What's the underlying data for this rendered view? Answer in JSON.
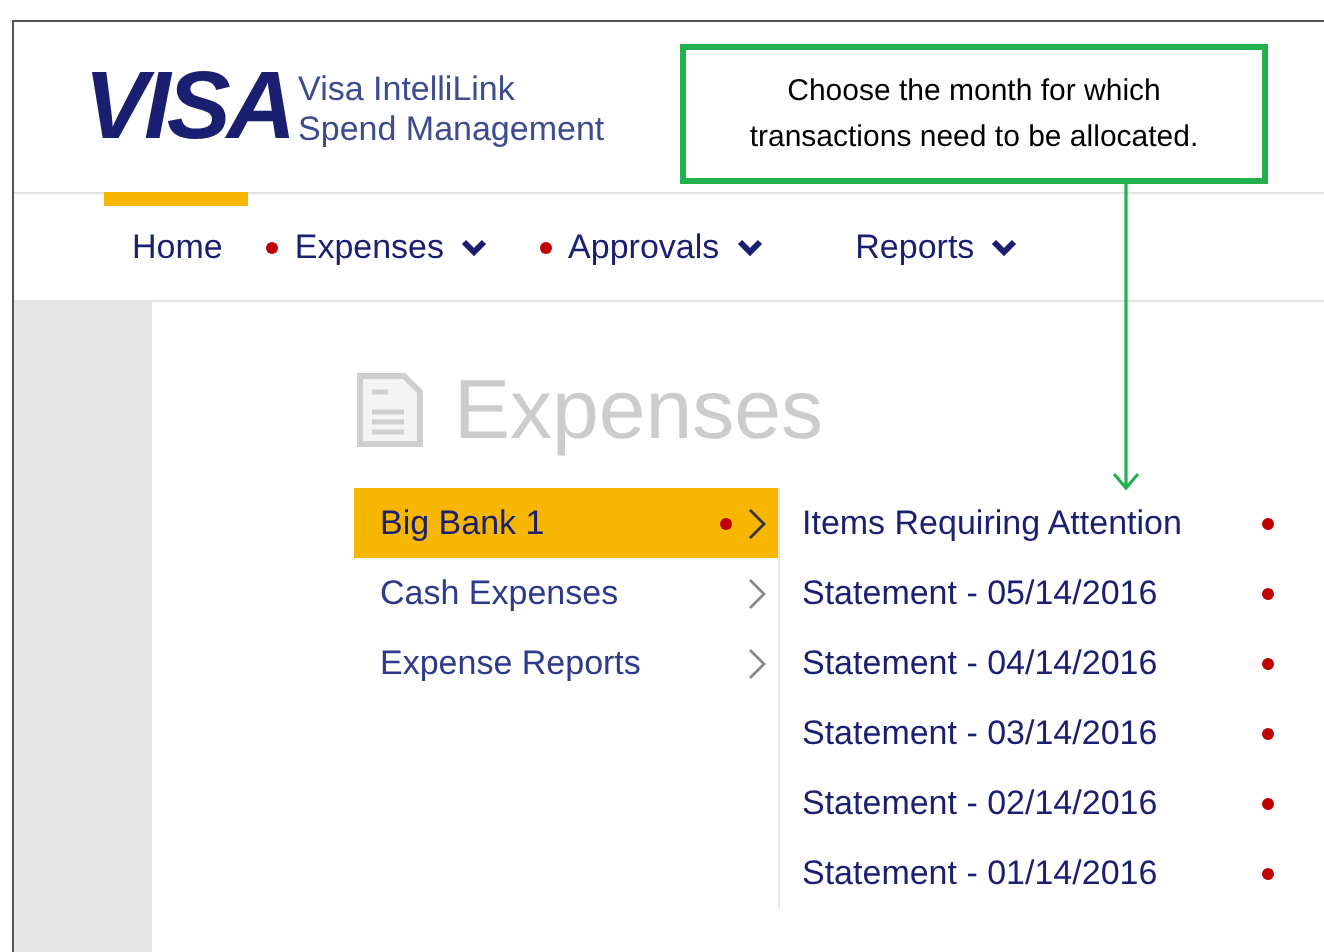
{
  "header": {
    "logo": "VISA",
    "product_lines": [
      "Visa IntelliLink",
      "Spend Management"
    ]
  },
  "nav": [
    {
      "label": "Home",
      "selected": true,
      "alert": false,
      "dropdown": false
    },
    {
      "label": "Expenses",
      "selected": false,
      "alert": true,
      "dropdown": true
    },
    {
      "label": "Approvals",
      "selected": false,
      "alert": true,
      "dropdown": true
    },
    {
      "label": "Reports",
      "selected": false,
      "alert": false,
      "dropdown": true
    }
  ],
  "page_title": "Expenses",
  "menu": [
    {
      "label": "Big Bank 1",
      "selected": true,
      "alert": true
    },
    {
      "label": "Cash Expenses",
      "selected": false,
      "alert": false
    },
    {
      "label": "Expense Reports",
      "selected": false,
      "alert": false
    }
  ],
  "submenu": [
    {
      "label": "Items Requiring Attention",
      "alert": true
    },
    {
      "label": "Statement - 05/14/2016",
      "alert": true
    },
    {
      "label": "Statement - 04/14/2016",
      "alert": true
    },
    {
      "label": "Statement - 03/14/2016",
      "alert": true
    },
    {
      "label": "Statement - 02/14/2016",
      "alert": true
    },
    {
      "label": "Statement - 01/14/2016",
      "alert": true
    }
  ],
  "callout": {
    "text": "Choose the month for which transactions need to be allocated."
  }
}
